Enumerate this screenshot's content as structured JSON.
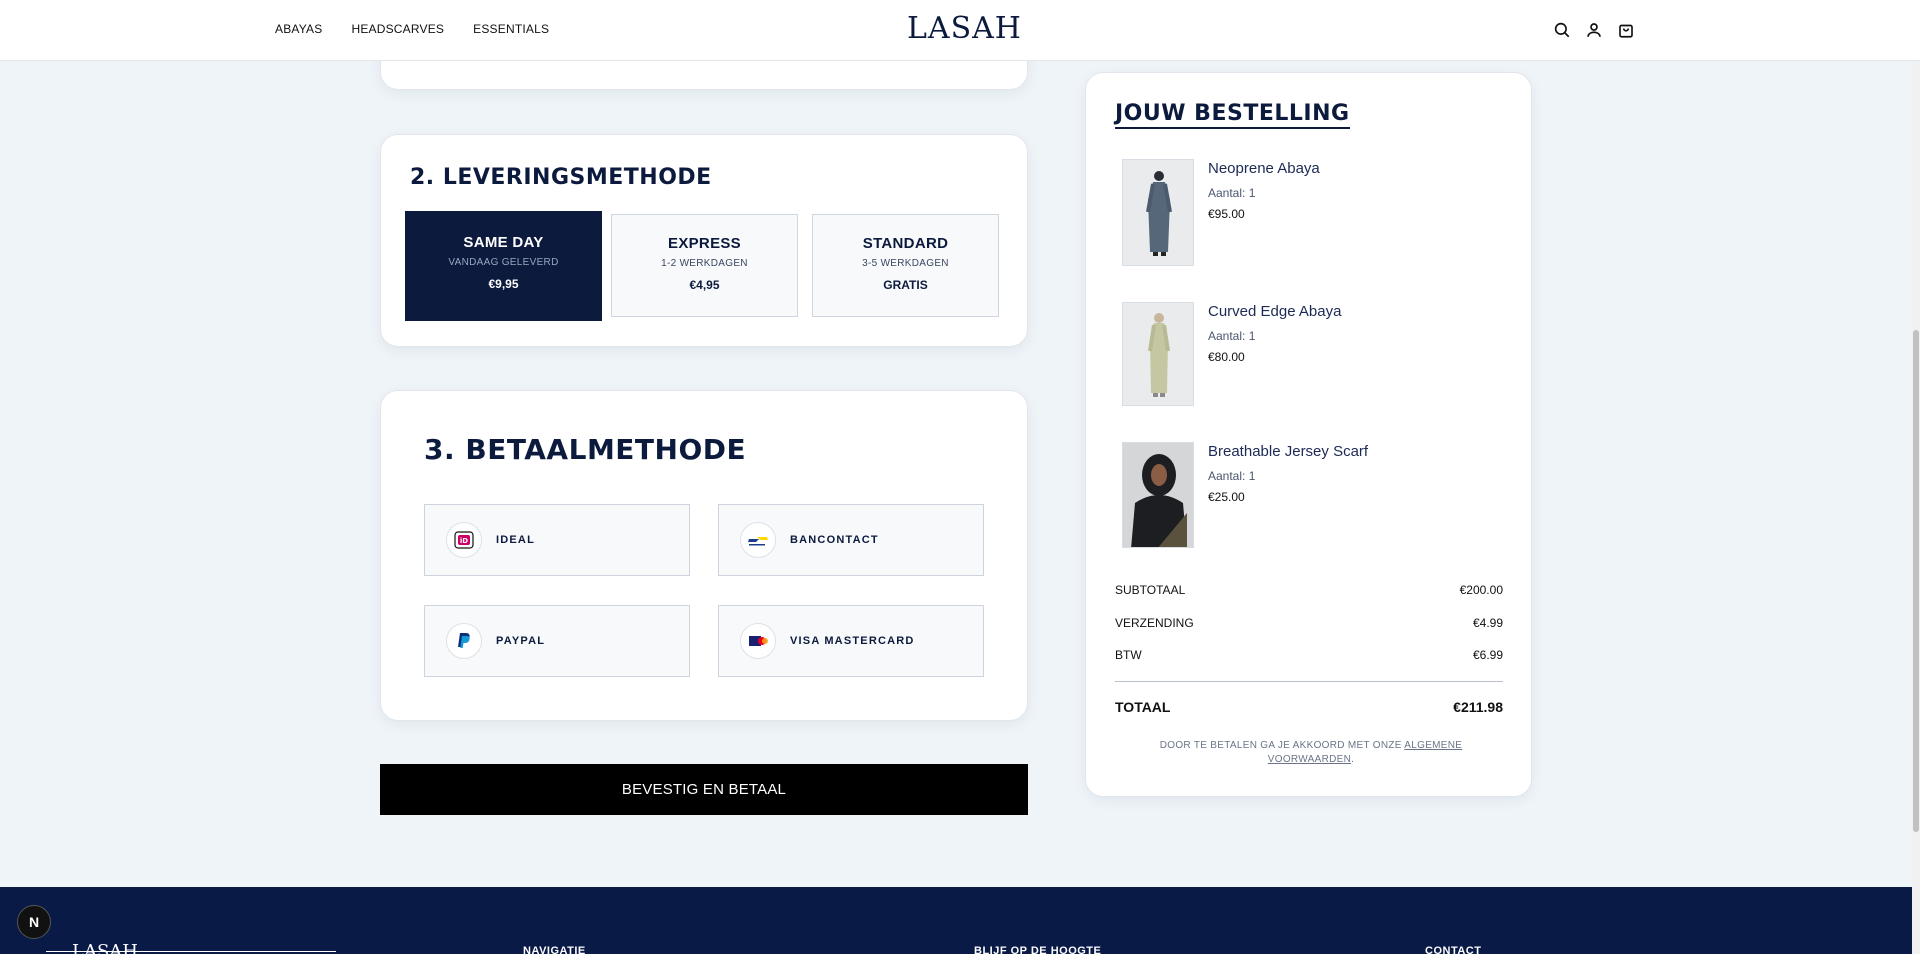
{
  "header": {
    "nav": [
      "ABAYAS",
      "HEADSCARVES",
      "ESSENTIALS"
    ],
    "logo": "LASAH",
    "icons": [
      "search-icon",
      "user-icon",
      "bag-icon"
    ]
  },
  "delivery": {
    "title": "2. LEVERINGSMETHODE",
    "options": [
      {
        "name": "SAME DAY",
        "sub": "VANDAAG GELEVERD",
        "price": "€9,95",
        "selected": true
      },
      {
        "name": "EXPRESS",
        "sub": "1-2 WERKDAGEN",
        "price": "€4,95",
        "selected": false
      },
      {
        "name": "STANDARD",
        "sub": "3-5 WERKDAGEN",
        "price": "GRATIS",
        "selected": false
      }
    ]
  },
  "payment": {
    "title": "3. BETAALMETHODE",
    "options": [
      {
        "label": "IDEAL",
        "icon": "ideal-icon"
      },
      {
        "label": "BANCONTACT",
        "icon": "bancontact-icon"
      },
      {
        "label": "PAYPAL",
        "icon": "paypal-icon"
      },
      {
        "label": "VISA MASTERCARD",
        "icon": "card-icon"
      }
    ]
  },
  "confirm_label": "BEVESTIG EN BETAAL",
  "order": {
    "title": "JOUW BESTELLING",
    "items": [
      {
        "name": "Neoprene Abaya",
        "qty": "Aantal: 1",
        "price": "€95.00"
      },
      {
        "name": "Curved Edge Abaya",
        "qty": "Aantal: 1",
        "price": "€80.00"
      },
      {
        "name": "Breathable Jersey Scarf",
        "qty": "Aantal: 1",
        "price": "€25.00"
      }
    ],
    "subtotal_label": "SUBTOTAAL",
    "subtotal": "€200.00",
    "shipping_label": "VERZENDING",
    "shipping": "€4.99",
    "vat_label": "BTW",
    "vat": "€6.99",
    "total_label": "TOTAAL",
    "total": "€211.98",
    "terms_prefix": "DOOR TE BETALEN GA JE AKKOORD MET ONZE",
    "terms_link": "ALGEMENE VOORWAARDEN",
    "terms_suffix": "."
  },
  "footer": {
    "logo": "LASAH",
    "columns": [
      "NAVIGATIE",
      "BLIJF OP DE HOOGTE",
      "CONTACT"
    ]
  },
  "fab_label": "N",
  "colors": {
    "navy": "#0b1a3d",
    "footer": "#0a1a47",
    "background": "#eef4f8"
  }
}
